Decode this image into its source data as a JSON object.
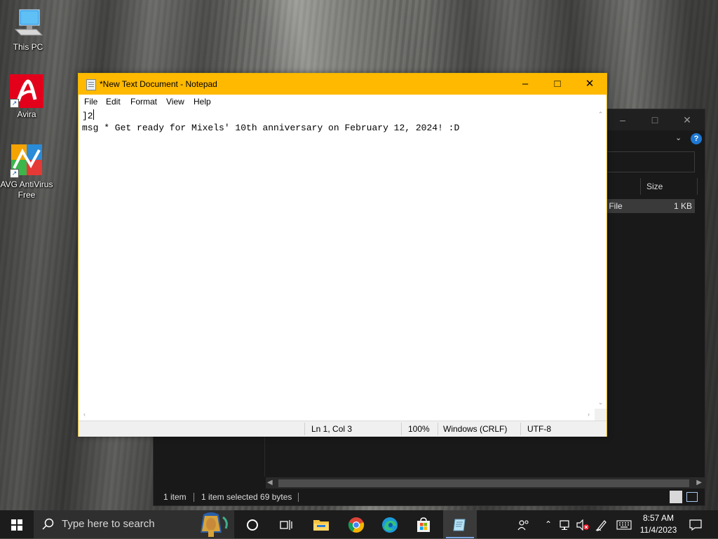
{
  "desktop": {
    "icons": [
      {
        "label": "This PC"
      },
      {
        "label": "Avira"
      },
      {
        "label": "AVG AntiVirus Free"
      }
    ]
  },
  "explorer": {
    "column_size": "Size",
    "row_name_partial": "tch File",
    "row_size": "1 KB",
    "status_items": "1 item",
    "status_selected": "1 item selected  69 bytes",
    "help_glyph": "?"
  },
  "notepad": {
    "title": "*New Text Document - Notepad",
    "menu": [
      "File",
      "Edit",
      "Format",
      "View",
      "Help"
    ],
    "lines": [
      "]2",
      "msg * Get ready for Mixels' 10th anniversary on February 12, 2024! :D"
    ],
    "status": {
      "position": "Ln 1, Col 3",
      "zoom": "100%",
      "line_ending": "Windows (CRLF)",
      "encoding": "UTF-8"
    },
    "accent_color": "#ffb900"
  },
  "taskbar": {
    "search_placeholder": "Type here to search",
    "clock_time": "8:57 AM",
    "clock_date": "11/4/2023",
    "pinned": [
      "task-view",
      "file-explorer",
      "chrome",
      "edge",
      "microsoft-store",
      "notepad"
    ]
  }
}
